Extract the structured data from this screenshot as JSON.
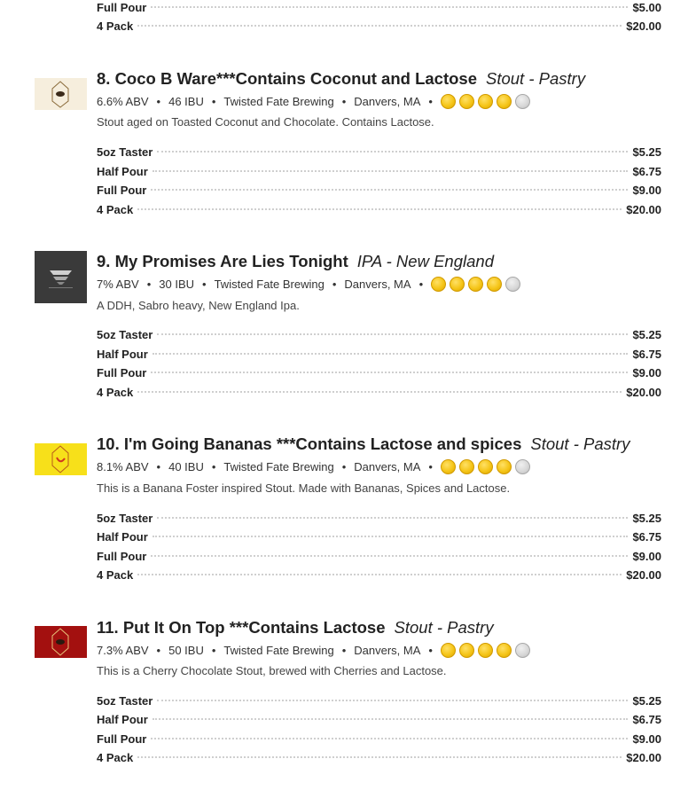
{
  "top_prices": [
    {
      "size": "Full Pour",
      "price": "$5.00"
    },
    {
      "size": "4 Pack",
      "price": "$20.00"
    }
  ],
  "items": [
    {
      "title": "8. Coco B Ware***Contains Coconut and Lactose",
      "style": "Stout - Pastry",
      "abv": "6.6% ABV",
      "ibu": "46 IBU",
      "brewery": "Twisted Fate Brewing",
      "location": "Danvers, MA",
      "rating": 4,
      "rating_max": 5,
      "description": "Stout aged on Toasted Coconut and Chocolate. Contains Lactose.",
      "logo_bg": "#f6eedd",
      "prices": [
        {
          "size": "5oz Taster",
          "price": "$5.25"
        },
        {
          "size": "Half Pour",
          "price": "$6.75"
        },
        {
          "size": "Full Pour",
          "price": "$9.00"
        },
        {
          "size": "4 Pack",
          "price": "$20.00"
        }
      ]
    },
    {
      "title": "9. My Promises Are Lies Tonight",
      "style": "IPA - New England",
      "abv": "7% ABV",
      "ibu": "30 IBU",
      "brewery": "Twisted Fate Brewing",
      "location": "Danvers, MA",
      "rating": 4,
      "rating_max": 5,
      "description": "A DDH, Sabro heavy, New England Ipa.",
      "logo_bg": "#3a3a3a",
      "prices": [
        {
          "size": "5oz Taster",
          "price": "$5.25"
        },
        {
          "size": "Half Pour",
          "price": "$6.75"
        },
        {
          "size": "Full Pour",
          "price": "$9.00"
        },
        {
          "size": "4 Pack",
          "price": "$20.00"
        }
      ]
    },
    {
      "title": "10. I'm Going Bananas ***Contains Lactose and spices",
      "style": "Stout - Pastry",
      "abv": "8.1% ABV",
      "ibu": "40 IBU",
      "brewery": "Twisted Fate Brewing",
      "location": "Danvers, MA",
      "rating": 4,
      "rating_max": 5,
      "description": "This is a Banana Foster inspired Stout. Made with Bananas, Spices and Lactose.",
      "logo_bg": "#f7e01a",
      "prices": [
        {
          "size": "5oz Taster",
          "price": "$5.25"
        },
        {
          "size": "Half Pour",
          "price": "$6.75"
        },
        {
          "size": "Full Pour",
          "price": "$9.00"
        },
        {
          "size": "4 Pack",
          "price": "$20.00"
        }
      ]
    },
    {
      "title": "11. Put It On Top ***Contains Lactose",
      "style": "Stout - Pastry",
      "abv": "7.3% ABV",
      "ibu": "50 IBU",
      "brewery": "Twisted Fate Brewing",
      "location": "Danvers, MA",
      "rating": 4,
      "rating_max": 5,
      "description": "This is a Cherry Chocolate Stout, brewed with Cherries and Lactose.",
      "logo_bg": "#a3100f",
      "prices": [
        {
          "size": "5oz Taster",
          "price": "$5.25"
        },
        {
          "size": "Half Pour",
          "price": "$6.75"
        },
        {
          "size": "Full Pour",
          "price": "$9.00"
        },
        {
          "size": "4 Pack",
          "price": "$20.00"
        }
      ]
    }
  ]
}
